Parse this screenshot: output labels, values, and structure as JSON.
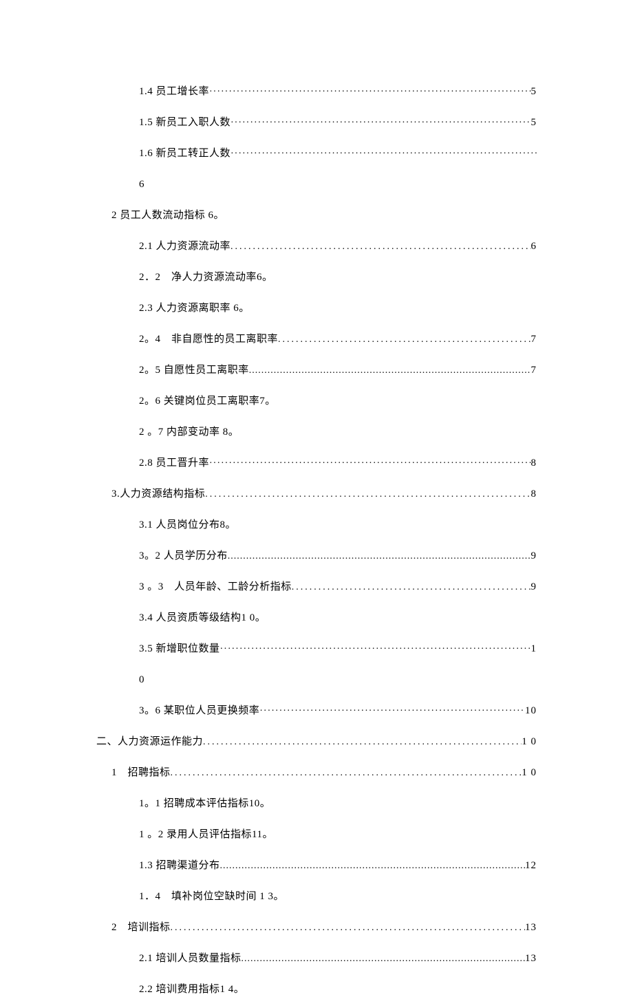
{
  "toc": {
    "items": [
      {
        "text": "1.4 员工增长率",
        "leader": "middot",
        "page": "5",
        "indent": 2
      },
      {
        "text": "1.5 新员工入职人数",
        "leader": "middot",
        "page": "5",
        "indent": 2
      },
      {
        "text": "1.6 新员工转正人数",
        "leader": "middot",
        "page": "",
        "indent": 2
      },
      {
        "text": "6",
        "leader": "none",
        "page": "",
        "indent": 2,
        "continuation": true
      },
      {
        "text": "2 员工人数流动指标 6。",
        "leader": "none",
        "page": "",
        "indent": 1
      },
      {
        "text": "2.1 人力资源流动率",
        "leader": "dotted",
        "page": "6",
        "indent": 2,
        "spacing": "wide"
      },
      {
        "text": "2．2　净人力资源流动率6。",
        "leader": "none",
        "page": "",
        "indent": 2
      },
      {
        "text": "2.3 人力资源离职率 6。",
        "leader": "none",
        "page": "",
        "indent": 2
      },
      {
        "text": "2。4　非自愿性的员工离职率",
        "leader": "dotted",
        "page": "7",
        "indent": 2,
        "spacing": "wide"
      },
      {
        "text": " 2。5 自愿性员工离职率",
        "leader": "dotted",
        "page": " 7",
        "indent": 2
      },
      {
        "text": "2。6 关键岗位员工离职率7。",
        "leader": "none",
        "page": "",
        "indent": 2
      },
      {
        "text": "2 。7 内部变动率 8。",
        "leader": "none",
        "page": "",
        "indent": 2
      },
      {
        "text": "2.8 员工晋升率",
        "leader": "middot",
        "page": "8",
        "indent": 2
      },
      {
        "text": "3.人力资源结构指标",
        "leader": "dotted",
        "page": "8",
        "indent": 1,
        "spacing": "wide"
      },
      {
        "text": "3.1 人员岗位分布8。",
        "leader": "none",
        "page": "",
        "indent": 2
      },
      {
        "text": "3。2 人员学历分布",
        "leader": "dotted",
        "page": "9",
        "indent": 2
      },
      {
        "text": " 3 。3　人员年龄、工龄分析指标",
        "leader": "dotted",
        "page": "9",
        "indent": 2,
        "spacing": "wide"
      },
      {
        "text": "3.4 人员资质等级结构1 0。",
        "leader": "none",
        "page": "",
        "indent": 2
      },
      {
        "text": " 3.5 新增职位数量",
        "leader": "middot",
        "page": "1",
        "indent": 2
      },
      {
        "text": " 0",
        "leader": "none",
        "page": "",
        "indent": 2,
        "continuation": true
      },
      {
        "text": "3。6 某职位人员更换频率",
        "leader": "middot",
        "page": "10",
        "indent": 2
      },
      {
        "text": "二、人力资源运作能力",
        "leader": "dotted",
        "page": " 1 0",
        "indent": 0,
        "spacing": "wide"
      },
      {
        "text": "1　招聘指标",
        "leader": "dotted",
        "page": "1 0",
        "indent": 1,
        "spacing": "wide"
      },
      {
        "text": "1。1 招聘成本评估指标10。",
        "leader": "none",
        "page": "",
        "indent": 2
      },
      {
        "text": " 1 。2 录用人员评估指标11。",
        "leader": "none",
        "page": "",
        "indent": 2
      },
      {
        "text": "1.3 招聘渠道分布",
        "leader": "dotted",
        "page": "12",
        "indent": 2
      },
      {
        "text": "1．4　填补岗位空缺时间 1 3。",
        "leader": "none",
        "page": "",
        "indent": 2
      },
      {
        "text": "2　培训指标",
        "leader": "dotted",
        "page": "13",
        "indent": 1,
        "spacing": "wide"
      },
      {
        "text": "2.1 培训人员数量指标",
        "leader": "dotted",
        "page": "13",
        "indent": 2
      },
      {
        "text": "2.2 培训费用指标1 4。",
        "leader": "none",
        "page": "",
        "indent": 2
      }
    ]
  }
}
